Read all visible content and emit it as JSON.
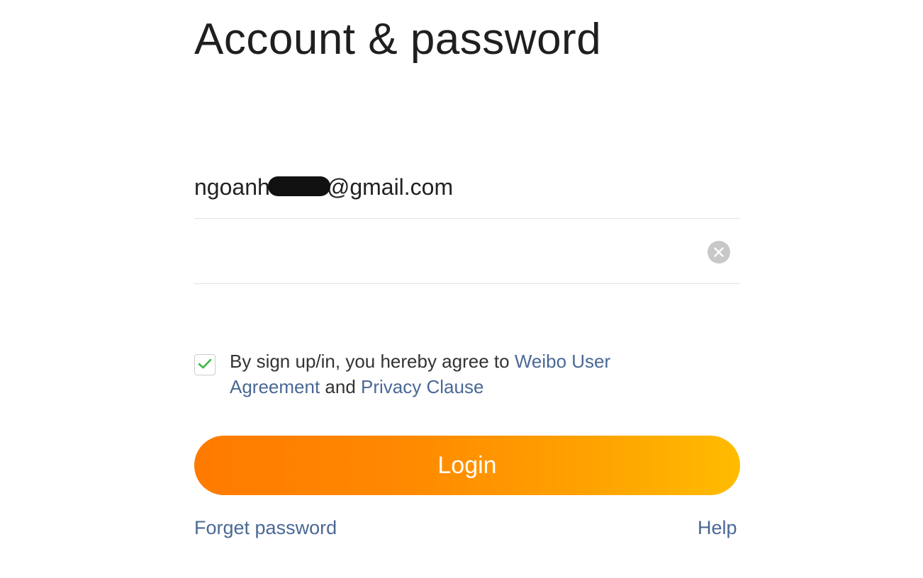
{
  "page": {
    "title": "Account & password"
  },
  "form": {
    "account_value": "ngoanhtri130@gmail.com",
    "password_value": ""
  },
  "icons": {
    "clear": "clear-circle-icon",
    "check": "checkmark-icon"
  },
  "agreement": {
    "checked": true,
    "prefix": "By sign up/in, you hereby agree to ",
    "user_agreement_link": "Weibo User Agreement",
    "joiner": " and ",
    "privacy_link": "Privacy Clause"
  },
  "actions": {
    "login_label": "Login",
    "forget_password_label": "Forget password",
    "help_label": "Help"
  },
  "colors": {
    "link": "#4a6896",
    "check": "#3cb84a",
    "login_gradient_start": "#ff7a00",
    "login_gradient_end": "#ffbc00"
  }
}
